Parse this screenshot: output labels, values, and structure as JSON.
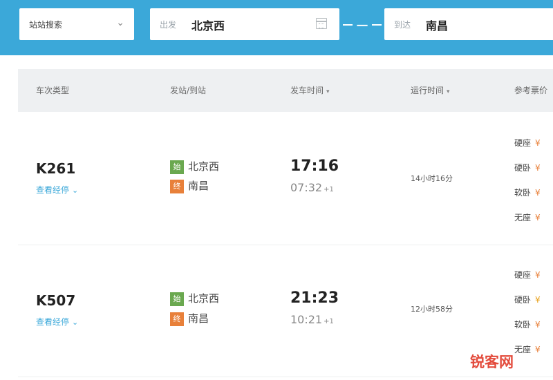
{
  "search": {
    "type_label": "站站搜索",
    "from_placeholder": "出发",
    "from_value": "北京西",
    "swap_label": "一",
    "to_placeholder": "到达",
    "to_value": "南昌"
  },
  "table": {
    "headers": {
      "train": "车次类型",
      "stations": "发站/到站",
      "time": "发车时间",
      "duration": "运行时间",
      "price": "参考票价"
    },
    "rows": [
      {
        "train": "K261",
        "route": "查看经停",
        "from_tag": "始",
        "from": "北京西",
        "to_tag": "终",
        "to": "南昌",
        "depart": "17:16",
        "arrive": "07:32",
        "arrive_day": "+1",
        "duration": "14小时16分",
        "seats": [
          "硬座",
          "硬卧",
          "软卧",
          "无座"
        ],
        "currency": "¥"
      },
      {
        "train": "K507",
        "route": "查看经停",
        "from_tag": "始",
        "from": "北京西",
        "to_tag": "终",
        "to": "南昌",
        "depart": "21:23",
        "arrive": "10:21",
        "arrive_day": "+1",
        "duration": "12小时58分",
        "seats": [
          "硬座",
          "硬卧",
          "软卧",
          "无座"
        ],
        "currency": "¥"
      }
    ]
  },
  "watermark": "锐客网",
  "colors": {
    "topbar": "#3ba8d9",
    "start_tag": "#6aa84f",
    "end_tag": "#e8803a",
    "price": "#e8803a",
    "link": "#3ba8d9"
  },
  "icons": {
    "type_dropdown": "chevron-down-icon",
    "calendar": "calendar-icon",
    "swap": "swap-icon",
    "sort": "sort-arrow-icon"
  }
}
